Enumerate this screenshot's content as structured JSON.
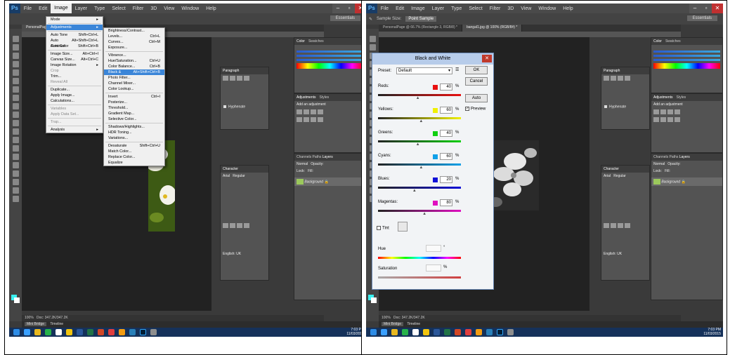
{
  "colors": {
    "accent": "#3a85d8",
    "ps_dark": "#3a3a3a",
    "dialog_title": "#b7ccea",
    "close_red": "#c0392b"
  },
  "menubar": {
    "items": [
      "File",
      "Edit",
      "Image",
      "Layer",
      "Type",
      "Select",
      "Filter",
      "3D",
      "View",
      "Window",
      "Help"
    ],
    "active": "Image"
  },
  "options_right": {
    "essentials": "Essentials",
    "sample_size_label": "Sample Size:",
    "sample_size_value": "Point Sample"
  },
  "tabs": {
    "left": "PersonalPage @ 66.7% (Rectangle 3, RGB/8) *",
    "right": "bangal1.jpg @ 100% (RGB/8#) *"
  },
  "image_menu": {
    "items": [
      {
        "label": "Mode",
        "shortcut": "",
        "arrow": true
      },
      {
        "sep": true
      },
      {
        "label": "Adjustments",
        "shortcut": "",
        "arrow": true,
        "highlight": true
      },
      {
        "sep": true
      },
      {
        "label": "Auto Tone",
        "shortcut": "Shift+Ctrl+L"
      },
      {
        "label": "Auto Contrast",
        "shortcut": "Alt+Shift+Ctrl+L"
      },
      {
        "label": "Auto Color",
        "shortcut": "Shift+Ctrl+B"
      },
      {
        "sep": true
      },
      {
        "label": "Image Size...",
        "shortcut": "Alt+Ctrl+I"
      },
      {
        "label": "Canvas Size...",
        "shortcut": "Alt+Ctrl+C"
      },
      {
        "label": "Image Rotation",
        "shortcut": "",
        "arrow": true
      },
      {
        "label": "Crop",
        "shortcut": "",
        "disabled": true
      },
      {
        "label": "Trim...",
        "shortcut": ""
      },
      {
        "label": "Reveal All",
        "shortcut": "",
        "disabled": true
      },
      {
        "sep": true
      },
      {
        "label": "Duplicate...",
        "shortcut": ""
      },
      {
        "label": "Apply Image...",
        "shortcut": ""
      },
      {
        "label": "Calculations...",
        "shortcut": ""
      },
      {
        "sep": true
      },
      {
        "label": "Variables",
        "shortcut": "",
        "disabled": true
      },
      {
        "label": "Apply Data Set...",
        "shortcut": "",
        "disabled": true
      },
      {
        "sep": true
      },
      {
        "label": "Trap...",
        "shortcut": "",
        "disabled": true
      },
      {
        "sep": true
      },
      {
        "label": "Analysis",
        "shortcut": "",
        "arrow": true
      }
    ]
  },
  "adjust_menu": {
    "items": [
      {
        "label": "Brightness/Contrast...",
        "shortcut": ""
      },
      {
        "label": "Levels...",
        "shortcut": "Ctrl+L"
      },
      {
        "label": "Curves...",
        "shortcut": "Ctrl+M"
      },
      {
        "label": "Exposure...",
        "shortcut": ""
      },
      {
        "sep": true
      },
      {
        "label": "Vibrance...",
        "shortcut": ""
      },
      {
        "label": "Hue/Saturation...",
        "shortcut": "Ctrl+U"
      },
      {
        "label": "Color Balance...",
        "shortcut": "Ctrl+B"
      },
      {
        "label": "Black & White...",
        "shortcut": "Alt+Shift+Ctrl+B",
        "highlight": true
      },
      {
        "label": "Photo Filter...",
        "shortcut": ""
      },
      {
        "label": "Channel Mixer...",
        "shortcut": ""
      },
      {
        "label": "Color Lookup...",
        "shortcut": ""
      },
      {
        "sep": true
      },
      {
        "label": "Invert",
        "shortcut": "Ctrl+I"
      },
      {
        "label": "Posterize...",
        "shortcut": ""
      },
      {
        "label": "Threshold...",
        "shortcut": ""
      },
      {
        "label": "Gradient Map...",
        "shortcut": ""
      },
      {
        "label": "Selective Color...",
        "shortcut": ""
      },
      {
        "sep": true
      },
      {
        "label": "Shadows/Highlights...",
        "shortcut": ""
      },
      {
        "label": "HDR Toning...",
        "shortcut": ""
      },
      {
        "label": "Variations...",
        "shortcut": ""
      },
      {
        "sep": true
      },
      {
        "label": "Desaturate",
        "shortcut": "Shift+Ctrl+U"
      },
      {
        "label": "Match Color...",
        "shortcut": ""
      },
      {
        "label": "Replace Color...",
        "shortcut": ""
      },
      {
        "label": "Equalize",
        "shortcut": ""
      }
    ]
  },
  "bw_dialog": {
    "title": "Black and White",
    "preset_label": "Preset:",
    "preset_value": "Default",
    "ok": "OK",
    "cancel": "Cancel",
    "auto": "Auto",
    "preview": "Preview",
    "tint": "Tint",
    "hue": "Hue",
    "saturation": "Saturation",
    "pct": "%",
    "deg": "°",
    "channels": [
      {
        "name": "Reds:",
        "value": 40,
        "color": "#e81010"
      },
      {
        "name": "Yellows:",
        "value": 60,
        "color": "#f0f000"
      },
      {
        "name": "Greens:",
        "value": 40,
        "color": "#10d010"
      },
      {
        "name": "Cyans:",
        "value": 60,
        "color": "#10a0e8"
      },
      {
        "name": "Blues:",
        "value": 20,
        "color": "#1010d8"
      },
      {
        "name": "Magentas:",
        "value": 80,
        "color": "#e010c0"
      }
    ]
  },
  "panels": {
    "color_tab": "Color",
    "swatches_tab": "Swatches",
    "adjustments_tab": "Adjustments",
    "styles_tab": "Styles",
    "add_adjustment": "Add an adjustment",
    "paragraph": "Paragraph",
    "hyphenate": "Hyphenate",
    "character": "Character",
    "font": "Arial",
    "style": "Regular",
    "layers": "Layers",
    "channels": "Channels",
    "paths": "Paths",
    "normal": "Normal",
    "opacity": "Opacity:",
    "fill": "Fill:",
    "lock": "Lock:",
    "background_layer": "Background",
    "lang": "English: UK",
    "aa": "Sharp"
  },
  "status": {
    "zoom": "100%",
    "doc": "Doc: 347.2K/347.2K"
  },
  "bridge": {
    "mini_bridge": "Mini Bridge",
    "timeline": "Timeline"
  },
  "clock": {
    "time": "7:03 PM",
    "date": "11/03/2015"
  }
}
